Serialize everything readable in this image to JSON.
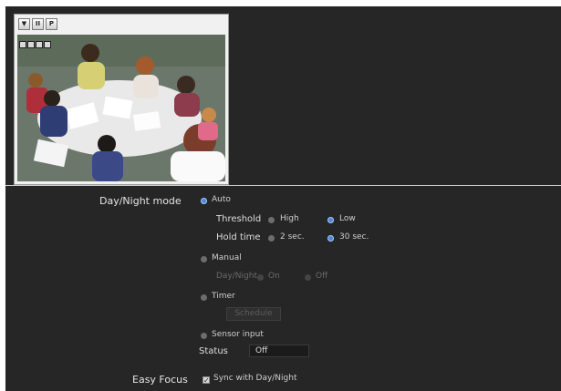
{
  "camera": {
    "toolbar": [
      "▼",
      "II",
      "P"
    ]
  },
  "day_night": {
    "label": "Day/Night mode",
    "auto_label": "Auto",
    "threshold_label": "Threshold",
    "threshold_high": "High",
    "threshold_low": "Low",
    "hold_time_label": "Hold time",
    "hold_2": "2 sec.",
    "hold_30": "30 sec.",
    "manual_label": "Manual",
    "daynight_label": "Day/Night",
    "manual_on": "On",
    "manual_off": "Off",
    "timer_label": "Timer",
    "schedule_button": "Schedule",
    "sensor_label": "Sensor input",
    "status_label": "Status",
    "status_value": "Off"
  },
  "easy_focus": {
    "label": "Easy Focus",
    "sync_label": "Sync with Day/Night"
  },
  "colors": {
    "panel_bg": "#262626",
    "radio_selected": "#4f86d6"
  }
}
